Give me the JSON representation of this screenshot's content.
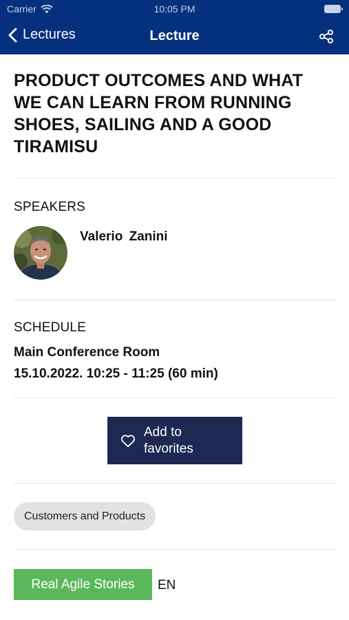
{
  "status_bar": {
    "carrier": "Carrier",
    "time": "10:05 PM"
  },
  "nav": {
    "back_label": "Lectures",
    "title": "Lecture"
  },
  "lecture": {
    "title": "PRODUCT OUTCOMES AND WHAT WE CAN LEARN FROM RUNNING SHOES, SAILING AND A GOOD TIRAMISU"
  },
  "speakers": {
    "label": "SPEAKERS",
    "items": [
      {
        "name": "Valerio  Zanini"
      }
    ]
  },
  "schedule": {
    "label": "SCHEDULE",
    "room": "Main Conference Room",
    "datetime": "15.10.2022. 10:25 - 11:25 (60 min)"
  },
  "favorites": {
    "label": "Add to favorites"
  },
  "tags": [
    "Customers and Products"
  ],
  "track": {
    "name": "Real Agile Stories",
    "color": "#5cb85c",
    "language": "EN"
  },
  "colors": {
    "nav_bg": "#05307e",
    "button_bg": "#1f2852",
    "chip_bg": "#e2e2e2"
  }
}
